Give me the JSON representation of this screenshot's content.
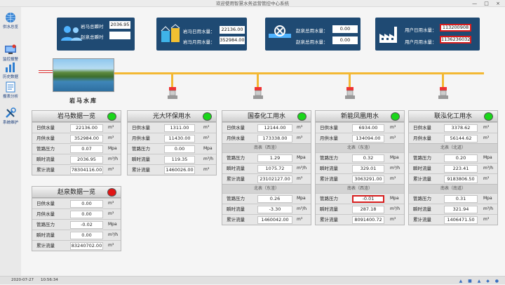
{
  "window": {
    "title": "欢迎使用智慧水务运营管控中心系统",
    "controls": "— □ ×"
  },
  "sidebar": {
    "items": [
      {
        "label": "供水总览",
        "icon": "globe-icon"
      },
      {
        "label": "监控报警",
        "icon": "alarm-monitor-icon"
      },
      {
        "label": "历史数据",
        "icon": "bar-chart-icon"
      },
      {
        "label": "报表分析",
        "icon": "report-icon"
      },
      {
        "label": "系统维护",
        "icon": "tools-icon"
      }
    ]
  },
  "summary": {
    "yanma": {
      "total_label": "岩马总瞬时",
      "total_value": "2036.95",
      "zhao_label": "赵泉总瞬时",
      "zhao_value": ""
    },
    "daily": {
      "day_label": "岩马日用水量：",
      "day_value": "22136.00",
      "month_label": "岩马月用水量：",
      "month_value": "352984.00"
    },
    "zhaoquan": {
      "label": "赵泉总用水量：",
      "value": "0.00",
      "label2": "赵泉总用水量：",
      "value2": "0.00"
    },
    "users": {
      "day_label": "用户日用水量：",
      "day_value": "113200908",
      "month_label": "用户月用水量：",
      "month_value": "1136236032"
    }
  },
  "reservoir": {
    "label": "岩马水库"
  },
  "units": {
    "m3": "m³",
    "mpa": "Mpa",
    "m3h": "m³/h"
  },
  "panels": {
    "yanma": {
      "title": "岩马数据一览",
      "status": "green",
      "rows": [
        {
          "k": "日供水量",
          "v": "22136.00",
          "u": "m³"
        },
        {
          "k": "月供水量",
          "v": "352984.00",
          "u": "m³"
        },
        {
          "k": "管路压力",
          "v": "0.07",
          "u": "Mpa"
        },
        {
          "k": "瞬时流量",
          "v": "2036.95",
          "u": "m³/h"
        },
        {
          "k": "累计流量",
          "v": "78304116.00",
          "u": "m³"
        }
      ]
    },
    "zhaoquan": {
      "title": "赵泉数据一览",
      "status": "red",
      "rows": [
        {
          "k": "日供水量",
          "v": "0.00",
          "u": "m³"
        },
        {
          "k": "月供水量",
          "v": "0.00",
          "u": "m³"
        },
        {
          "k": "管路压力",
          "v": "-0.02",
          "u": "Mpa"
        },
        {
          "k": "瞬时流量",
          "v": "0.00",
          "u": "m³/h"
        },
        {
          "k": "累计流量",
          "v": "83240702.00",
          "u": "m³"
        }
      ]
    },
    "guangda": {
      "title": "光大环保用水",
      "status": "green",
      "rows": [
        {
          "k": "日供水量",
          "v": "1311.00",
          "u": "m³"
        },
        {
          "k": "月供水量",
          "v": "11430.00",
          "u": "m³"
        },
        {
          "k": "管路压力",
          "v": "0.00",
          "u": "Mpa"
        },
        {
          "k": "瞬时流量",
          "v": "119.35",
          "u": "m³/h"
        },
        {
          "k": "累计流量",
          "v": "1460026.00",
          "u": "m³"
        }
      ]
    },
    "guotai": {
      "title": "国泰化工用水",
      "status": "green",
      "top": [
        {
          "k": "日供水量",
          "v": "12144.00",
          "u": "m³"
        },
        {
          "k": "月供水量",
          "v": "173338.00",
          "u": "m³"
        }
      ],
      "sec1": "南表（西渣）",
      "rows1": [
        {
          "k": "管路压力",
          "v": "1.29",
          "u": "Mpa"
        },
        {
          "k": "瞬时流量",
          "v": "1075.72",
          "u": "m³/h"
        },
        {
          "k": "累计流量",
          "v": "23102127.00",
          "u": "m³"
        }
      ],
      "sec2": "北表（东渣）",
      "rows2": [
        {
          "k": "管路压力",
          "v": "0.26",
          "u": "Mpa"
        },
        {
          "k": "瞬时流量",
          "v": "-3.30",
          "u": "m³/h"
        },
        {
          "k": "累计流量",
          "v": "1460042.00",
          "u": "m³"
        }
      ]
    },
    "xinneng": {
      "title": "新能凤凰用水",
      "status": "green",
      "top": [
        {
          "k": "日供水量",
          "v": "6934.00",
          "u": "m³"
        },
        {
          "k": "月供水量",
          "v": "134094.00",
          "u": "m³"
        }
      ],
      "sec1": "北表（东渣）",
      "rows1": [
        {
          "k": "管路压力",
          "v": "0.32",
          "u": "Mpa"
        },
        {
          "k": "瞬时流量",
          "v": "329.01",
          "u": "m³/h"
        },
        {
          "k": "累计流量",
          "v": "3063291.00",
          "u": "m³"
        }
      ],
      "sec2": "南表（西渣）",
      "rows2": [
        {
          "k": "管路压力",
          "v": "-0.01",
          "u": "Mpa",
          "alert": true
        },
        {
          "k": "瞬时流量",
          "v": "287.18",
          "u": "m³/h"
        },
        {
          "k": "累计流量",
          "v": "8091400.72",
          "u": "m³"
        }
      ]
    },
    "lianhong": {
      "title": "联泓化工用水",
      "status": "green",
      "top": [
        {
          "k": "日供水量",
          "v": "3378.62",
          "u": "m³"
        },
        {
          "k": "月供水量",
          "v": "56144.62",
          "u": "m³"
        }
      ],
      "sec1": "北表（北道）",
      "rows1": [
        {
          "k": "管路压力",
          "v": "0.20",
          "u": "Mpa"
        },
        {
          "k": "瞬时流量",
          "v": "223.41",
          "u": "m³/h"
        },
        {
          "k": "累计流量",
          "v": "9183806.50",
          "u": "m³"
        }
      ],
      "sec2": "南表（南道）",
      "rows2": [
        {
          "k": "管路压力",
          "v": "0.31",
          "u": "Mpa"
        },
        {
          "k": "瞬时流量",
          "v": "321.94",
          "u": "m³/h"
        },
        {
          "k": "累计流量",
          "v": "1406471.50",
          "u": "m³"
        }
      ]
    }
  },
  "statusbar": {
    "date": "2020-07-27",
    "time": "10:56:34",
    "tray": "▲ ■ ▲ ◆ ●"
  }
}
